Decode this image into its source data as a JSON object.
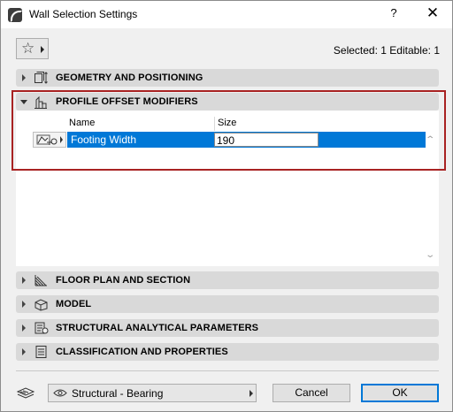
{
  "window": {
    "title": "Wall Selection Settings",
    "help_label": "?",
    "close_label": "✕"
  },
  "toolbar": {
    "favorites_icon": "star-icon",
    "selection_info": "Selected: 1 Editable: 1"
  },
  "panels": [
    {
      "label": "GEOMETRY AND POSITIONING",
      "icon": "geometry-icon",
      "expanded": false
    },
    {
      "label": "PROFILE OFFSET MODIFIERS",
      "icon": "profile-offset-icon",
      "expanded": true
    },
    {
      "label": "FLOOR PLAN AND SECTION",
      "icon": "floor-plan-icon",
      "expanded": false
    },
    {
      "label": "MODEL",
      "icon": "model-icon",
      "expanded": false
    },
    {
      "label": "STRUCTURAL ANALYTICAL PARAMETERS",
      "icon": "structural-analytical-icon",
      "expanded": false
    },
    {
      "label": "CLASSIFICATION AND PROPERTIES",
      "icon": "classification-icon",
      "expanded": false
    }
  ],
  "profile_table": {
    "columns": [
      "Name",
      "Size"
    ],
    "rows": [
      {
        "name": "Footing Width",
        "size": "190",
        "selected": true
      }
    ]
  },
  "footer": {
    "structure_icon": "structure-layers-icon",
    "structure_value": "Structural - Bearing",
    "cancel_label": "Cancel",
    "ok_label": "OK"
  },
  "colors": {
    "selection": "#0078d7",
    "highlight_border": "#a82222",
    "panel_header": "#d9d9d9"
  }
}
